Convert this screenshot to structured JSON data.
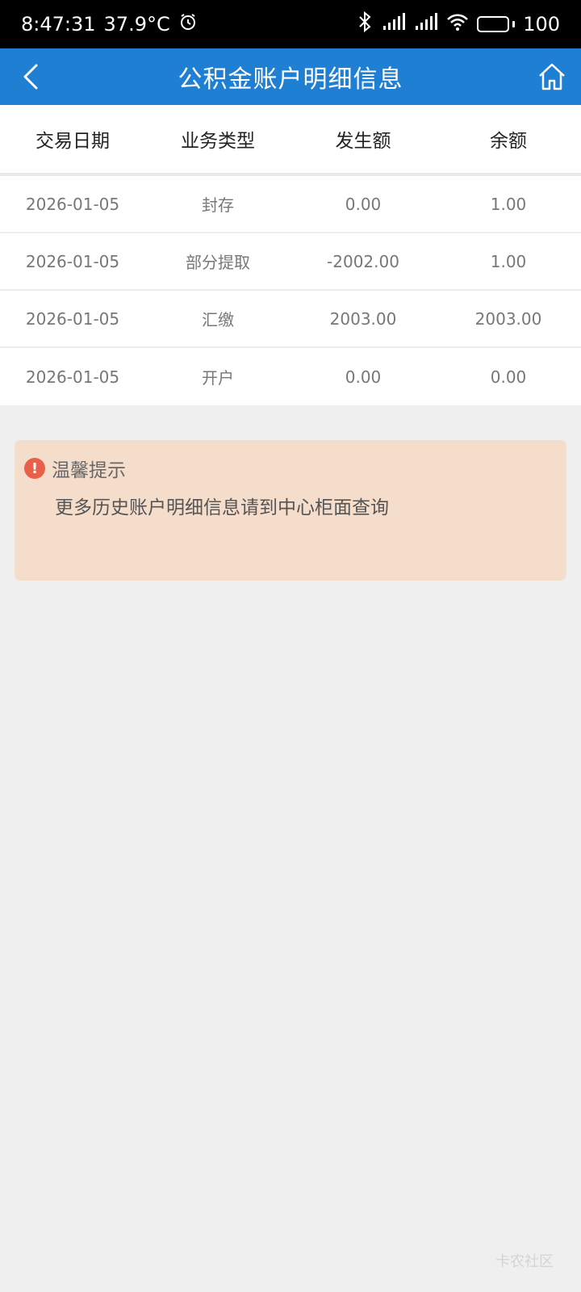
{
  "status_bar": {
    "time": "8:47:31",
    "temperature": "37.9°C",
    "battery": "100",
    "icons": [
      "alarm-icon",
      "bluetooth-icon",
      "signal-icon",
      "signal-icon",
      "wifi-icon",
      "battery-icon"
    ]
  },
  "nav": {
    "title": "公积金账户明细信息",
    "back_icon": "back-arrow-icon",
    "home_icon": "home-icon"
  },
  "table": {
    "headers": [
      "交易日期",
      "业务类型",
      "发生额",
      "余额"
    ],
    "rows": [
      [
        "2026-01-05",
        "封存",
        "0.00",
        "1.00"
      ],
      [
        "2026-01-05",
        "部分提取",
        "-2002.00",
        "1.00"
      ],
      [
        "2026-01-05",
        "汇缴",
        "2003.00",
        "2003.00"
      ],
      [
        "2026-01-05",
        "开户",
        "0.00",
        "0.00"
      ]
    ]
  },
  "tip": {
    "title": "温馨提示",
    "text": "更多历史账户明细信息请到中心柜面查询",
    "icon": "exclamation-icon"
  },
  "watermark": "卡农社区",
  "colors": {
    "nav_bg": "#1e7fd3",
    "tip_bg": "#f5ddcc",
    "tip_icon": "#e8604c",
    "page_bg": "#efefef"
  }
}
